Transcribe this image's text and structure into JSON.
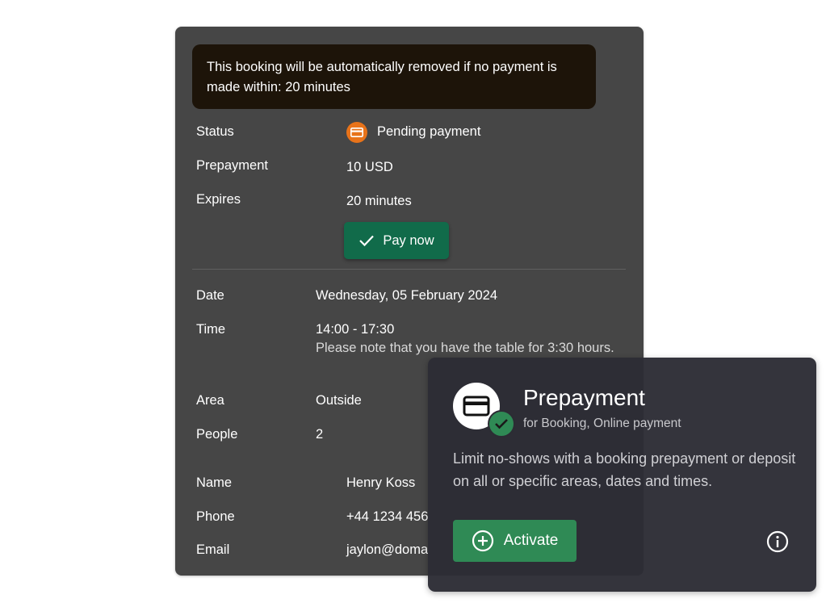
{
  "booking": {
    "warning": "This booking will be automatically removed if no payment is made within: 20 minutes",
    "status_label": "Status",
    "status_value": "Pending payment",
    "prepayment_label": "Prepayment",
    "prepayment_value": "10 USD",
    "expires_label": "Expires",
    "expires_value": "20 minutes",
    "pay_button": "Pay now",
    "date_label": "Date",
    "date_value": "Wednesday, 05 February 2024",
    "time_label": "Time",
    "time_value": "14:00 - 17:30",
    "time_note": "Please note that you have the table for 3:30 hours.",
    "area_label": "Area",
    "area_value": "Outside",
    "people_label": "People",
    "people_value": "2",
    "name_label": "Name",
    "name_value": "Henry Koss",
    "phone_label": "Phone",
    "phone_value": "+44 1234 456",
    "email_label": "Email",
    "email_value": "jaylon@doma"
  },
  "promo": {
    "title": "Prepayment",
    "subtitle": "for Booking, Online payment",
    "description": "Limit no-shows with a booking prepayment or deposit on all or specific areas, dates and times.",
    "activate_button": "Activate"
  },
  "colors": {
    "card_bg": "#464646",
    "warning_bg": "#1d1409",
    "status_orange": "#e8731a",
    "pay_green": "#116b4a",
    "activate_green": "#2f8a55",
    "promo_bg": "#2c2c34"
  },
  "icons": {
    "status": "credit-card-icon",
    "pay": "check-icon",
    "promo_logo": "credit-card-icon",
    "promo_badge": "check-circle-icon",
    "activate": "plus-circle-icon",
    "info": "info-icon"
  }
}
